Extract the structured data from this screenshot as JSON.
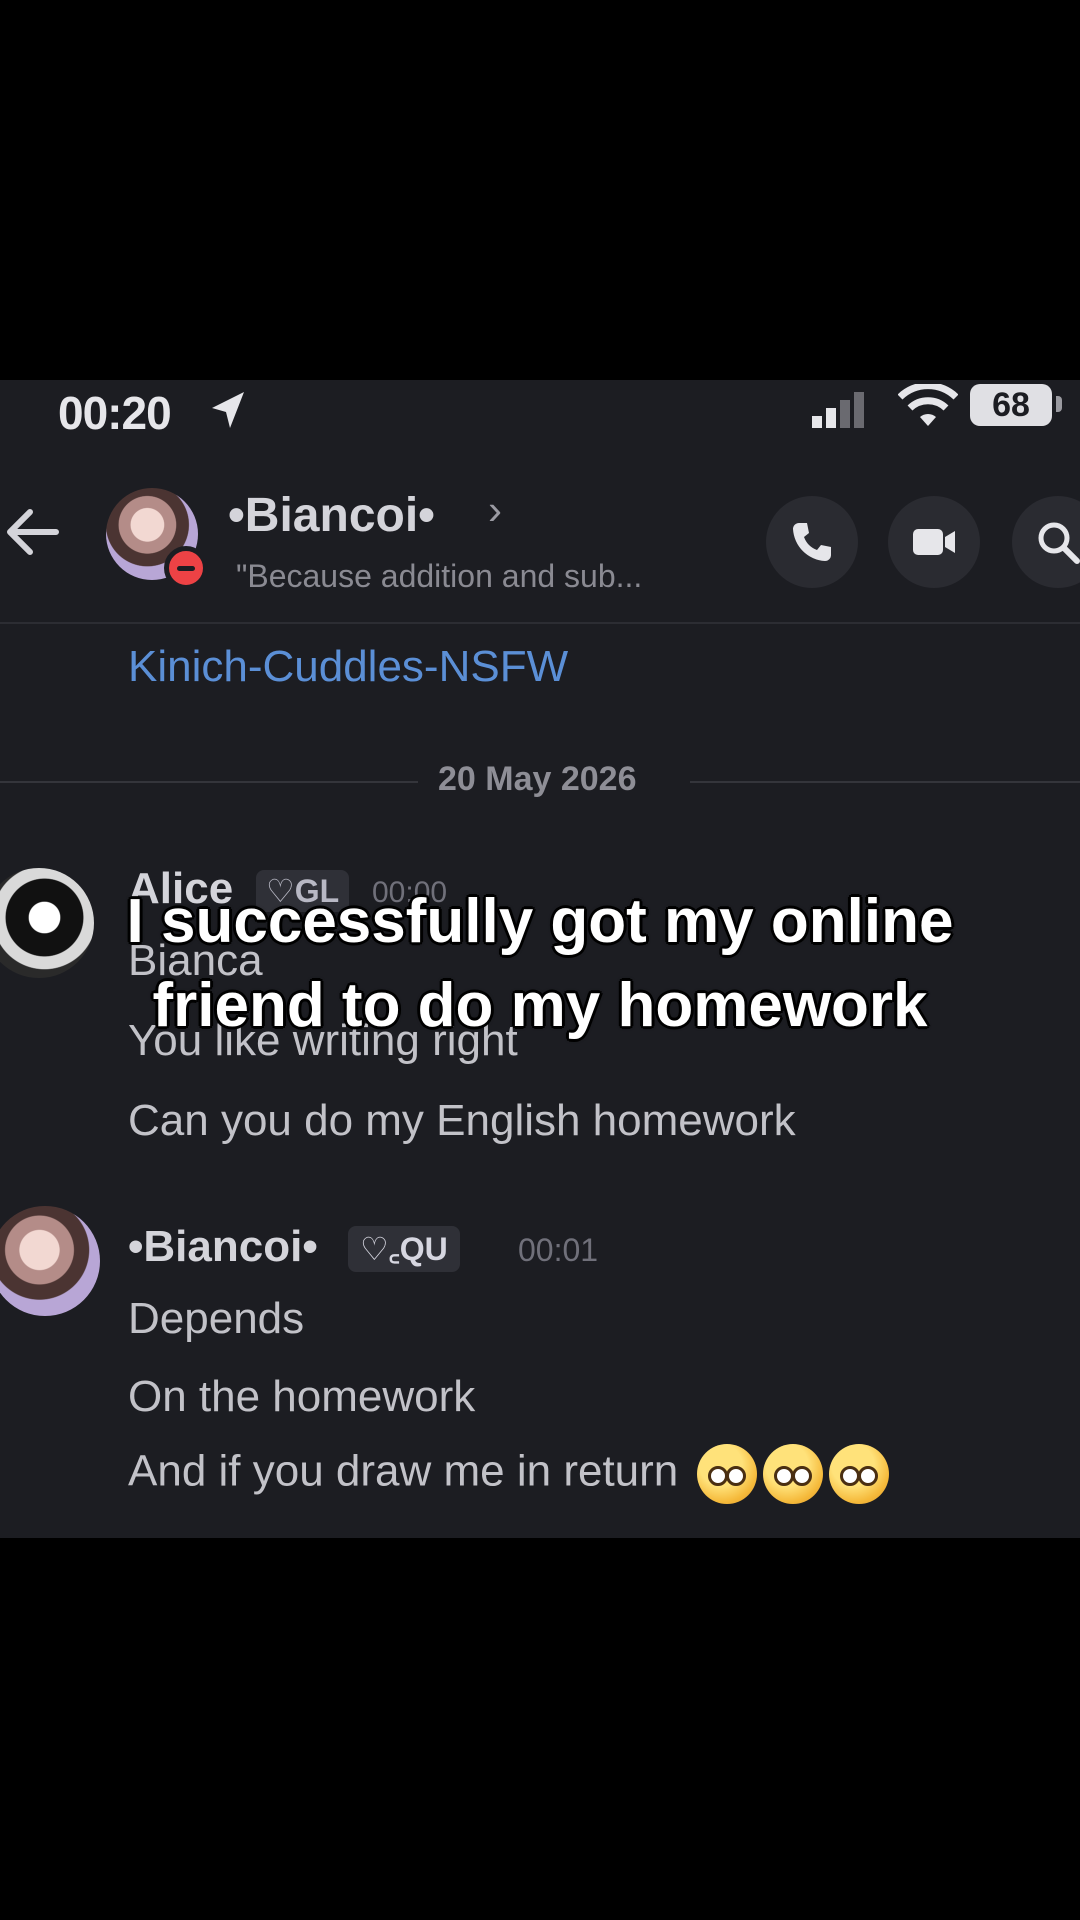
{
  "status_bar": {
    "time": "00:20",
    "battery": "68"
  },
  "header": {
    "name": "•Biancoi•",
    "chevron": "›",
    "status_text": "\"Because addition and sub..."
  },
  "messages": {
    "link": "Kinich-Cuddles-NSFW",
    "date_divider": "20 May 2026",
    "alice": {
      "name": "Alice",
      "tag": "♡GL",
      "time": "00:00",
      "lines": [
        "Bianca",
        "You like writing right",
        "Can you do my English homework"
      ]
    },
    "bianca": {
      "name": "•Biancoi•",
      "tag": "♡꜀QU",
      "time": "00:01",
      "lines": [
        "Depends",
        "On the homework",
        "And if you draw me in return"
      ]
    }
  },
  "caption": {
    "line1": "I successfully got my online",
    "line2": "friend to do my homework"
  },
  "colors": {
    "app_background": "#1c1d22",
    "link": "#5b8fd6",
    "dnd_badge": "#ed4245"
  },
  "icons": [
    "location-arrow-icon",
    "signal-icon",
    "wifi-icon",
    "back-arrow-icon",
    "phone-icon",
    "video-camera-icon",
    "search-icon",
    "pleading-face-emoji"
  ]
}
